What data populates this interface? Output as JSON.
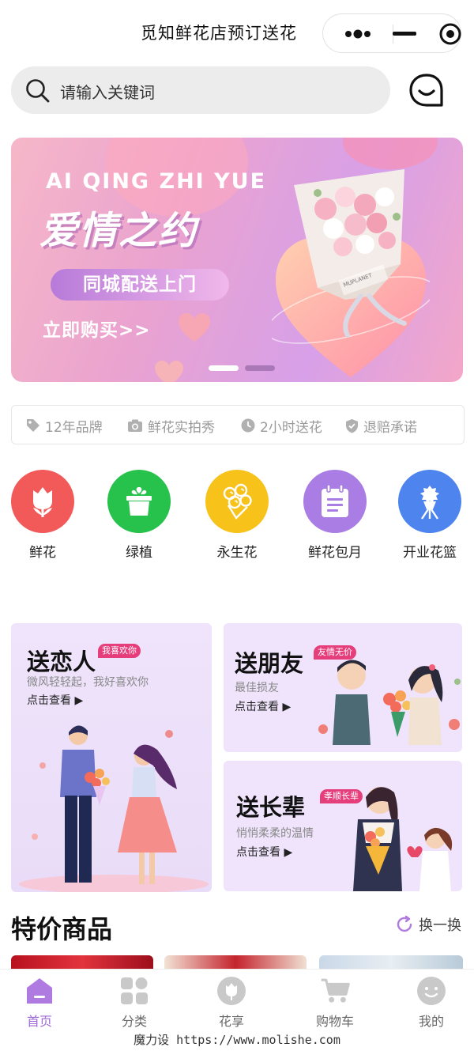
{
  "nav": {
    "title": "觅知鲜花店预订送花"
  },
  "search": {
    "placeholder": "请输入关键词"
  },
  "banner": {
    "subtitle": "AI QING ZHI YUE",
    "title": "爱情之约",
    "pill": "同城配送上门",
    "cta": "立即购买>>",
    "wrap_text": "MUPLANET"
  },
  "features": [
    {
      "label": "12年品牌",
      "icon": "tag-icon"
    },
    {
      "label": "鲜花实拍秀",
      "icon": "camera-icon"
    },
    {
      "label": "2小时送花",
      "icon": "clock-icon"
    },
    {
      "label": "退赔承诺",
      "icon": "shield-icon"
    }
  ],
  "categories": [
    {
      "label": "鲜花",
      "color": "#f25a5a",
      "icon": "tulip-icon"
    },
    {
      "label": "绿植",
      "color": "#27c24c",
      "icon": "plant-pot-icon"
    },
    {
      "label": "永生花",
      "color": "#f7c21a",
      "icon": "rose-bouquet-icon"
    },
    {
      "label": "鲜花包月",
      "color": "#a97de3",
      "icon": "calendar-icon"
    },
    {
      "label": "开业花篮",
      "color": "#4d84ee",
      "icon": "flower-basket-icon"
    }
  ],
  "cards": {
    "lover": {
      "title": "送恋人",
      "tag": "我喜欢你",
      "subtitle": "微风轻轻起，我好喜欢你",
      "link": "点击查看 ▶"
    },
    "friend": {
      "title": "送朋友",
      "tag": "友情无价",
      "subtitle": "最佳损友",
      "link": "点击查看 ▶"
    },
    "elder": {
      "title": "送长辈",
      "tag": "孝顺长辈",
      "subtitle": "悄悄柔柔的温情",
      "link": "点击查看 ▶"
    }
  },
  "special": {
    "title": "特价商品",
    "refresh": "换一换"
  },
  "tabs": [
    {
      "label": "首页",
      "icon": "home-icon",
      "active": true
    },
    {
      "label": "分类",
      "icon": "grid-icon",
      "active": false
    },
    {
      "label": "花享",
      "icon": "flower-share-icon",
      "active": false
    },
    {
      "label": "购物车",
      "icon": "cart-icon",
      "active": false
    },
    {
      "label": "我的",
      "icon": "profile-icon",
      "active": false
    }
  ],
  "footer": "魔力设 https://www.molishe.com",
  "colors": {
    "accent": "#a06ad8",
    "tag": "#e53e7a"
  }
}
